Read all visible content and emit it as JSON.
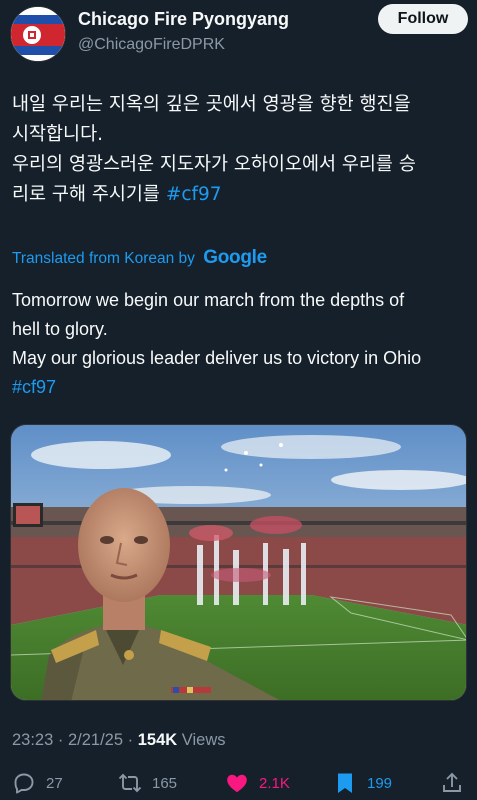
{
  "account": {
    "display_name": "Chicago Fire Pyongyang",
    "handle": "@ChicagoFireDPRK",
    "follow_label": "Follow"
  },
  "tweet": {
    "korean_lines": [
      "내일 우리는 지옥의 깊은 곳에서 영광을 향한 행진을",
      "시작합니다.",
      "우리의 영광스러운 지도자가 오하이오에서 우리를 승",
      "리로 구해 주시기를"
    ],
    "korean_hashtag": "#cf97",
    "translated_label": "Translated from Korean by",
    "translator": "Google",
    "english_lines": [
      "Tomorrow we begin our march from the depths of",
      "hell to glory.",
      "May our glorious leader deliver us to victory in Ohio"
    ],
    "english_hashtag": "#cf97"
  },
  "meta": {
    "time": "23:23",
    "separator": "·",
    "date": "2/21/25",
    "views_count": "154K",
    "views_label": "Views"
  },
  "actions": {
    "replies": "27",
    "retweets": "165",
    "likes": "2.1K",
    "bookmarks": "199"
  },
  "colors": {
    "background": "#15202b",
    "text": "#f7f9f9",
    "secondary": "#8b98a5",
    "link": "#1d9bf0",
    "like": "#f91880"
  }
}
